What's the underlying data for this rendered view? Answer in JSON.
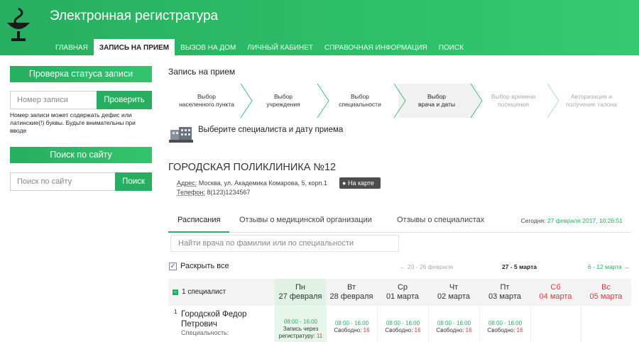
{
  "site": {
    "title": "Электронная регистратура"
  },
  "nav": [
    "ГЛАВНАЯ",
    "ЗАПИСЬ НА ПРИЕМ",
    "ВЫЗОВ НА ДОМ",
    "ЛИЧНЫЙ КАБИНЕТ",
    "СПРАВОЧНАЯ ИНФОРМАЦИЯ",
    "ПОИСК"
  ],
  "sidebar": {
    "status_title": "Проверка статуса записи",
    "record_placeholder": "Номер записи",
    "check_button": "Проверить",
    "note": "Номер записи может содержать дефис или латинские(!) буквы. Будьте внимательны при вводе",
    "search_title": "Поиск по сайту",
    "search_placeholder": "Поиск по сайту",
    "search_button": "Поиск"
  },
  "main": {
    "title": "Запись на прием",
    "steps": [
      {
        "l1": "Выбор",
        "l2": "населенного пункта",
        "state": "done"
      },
      {
        "l1": "Выбор",
        "l2": "учреждения",
        "state": "done"
      },
      {
        "l1": "Выбор",
        "l2": "специальности",
        "state": "done"
      },
      {
        "l1": "Выбор",
        "l2": "врача и даты",
        "state": "current"
      },
      {
        "l1": "Выбор времени",
        "l2": "посещения",
        "state": "future"
      },
      {
        "l1": "Авторизация и",
        "l2": "получение талона",
        "state": "future"
      }
    ],
    "subheading": "Выберите специалиста и дату приема",
    "clinic": {
      "name": "ГОРОДСКАЯ ПОЛИКЛИНИКА №12",
      "address_label": "Адрес:",
      "address": "Москва, ул. Академика Комарова, 5, корп.1",
      "phone_label": "Телефон:",
      "phone": "8(123)1234567",
      "map_button": "На карте"
    },
    "tabs": [
      "Расписания",
      "Отзывы о медицинской организации",
      "Отзывы о специалистах"
    ],
    "today_label": "Сегодня:",
    "today_value": "27 февраля 2017, 10:26:51",
    "doctor_search_placeholder": "Найти врача по фамилии или по специальности",
    "expand_all": "Раскрыть все",
    "week_prev": "← 20 - 26 февраля",
    "week_current": "27 - 5 марта",
    "week_next": "6 - 12 марта →"
  },
  "schedule": {
    "spec_count": "1 специалист",
    "days": [
      {
        "dow": "Пн",
        "date": "27 февраля"
      },
      {
        "dow": "Вт",
        "date": "28 февраля"
      },
      {
        "dow": "Ср",
        "date": "01 марта"
      },
      {
        "dow": "Чт",
        "date": "02 марта"
      },
      {
        "dow": "Пт",
        "date": "03 марта"
      },
      {
        "dow": "Сб",
        "date": "04 марта"
      },
      {
        "dow": "Вс",
        "date": "05 марта"
      }
    ],
    "doctor": {
      "num": "1",
      "name_line1": "Городской Федор",
      "name_line2": "Петрович",
      "spec_label": "Специальность:"
    },
    "slots": [
      {
        "time": "08:00 - 16:00",
        "label": "Запись через",
        "label2": "регистратуру:",
        "count": "11"
      },
      {
        "time": "08:00 - 16:00",
        "label": "Свободно:",
        "count": "16"
      },
      {
        "time": "08:00 - 16:00",
        "label": "Свободно:",
        "count": "16"
      },
      {
        "time": "08:00 - 16:00",
        "label": "Свободно:",
        "count": "16"
      },
      {
        "time": "08:00 - 16:00",
        "label": "Свободно:",
        "count": "16"
      }
    ]
  },
  "colors": {
    "accent": "#27ae60",
    "weekend": "#d43c3c"
  },
  "icons": [
    "bowl-of-hygieia-icon",
    "building-icon",
    "globe-icon",
    "checkbox-icon",
    "minus-icon"
  ]
}
